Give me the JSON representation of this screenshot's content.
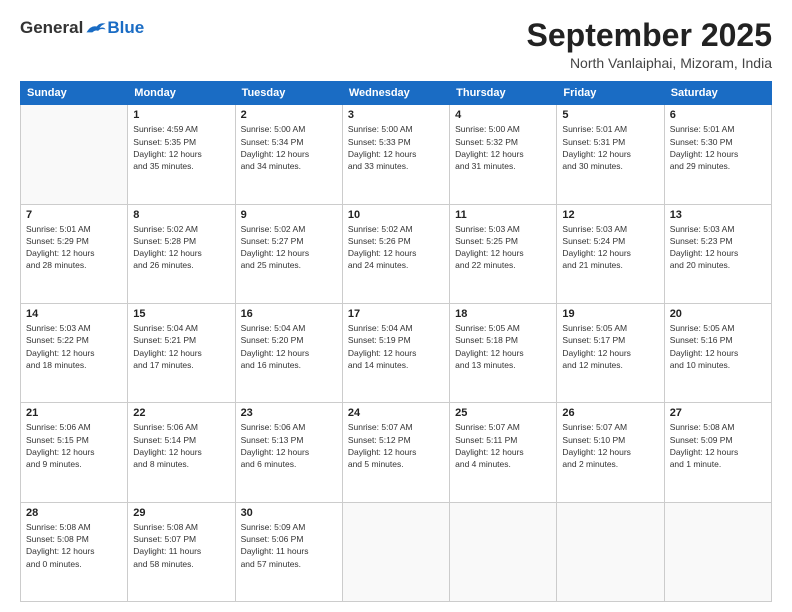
{
  "header": {
    "logo_general": "General",
    "logo_blue": "Blue",
    "month_title": "September 2025",
    "location": "North Vanlaiphai, Mizoram, India"
  },
  "weekdays": [
    "Sunday",
    "Monday",
    "Tuesday",
    "Wednesday",
    "Thursday",
    "Friday",
    "Saturday"
  ],
  "weeks": [
    [
      {
        "day": "",
        "info": ""
      },
      {
        "day": "1",
        "info": "Sunrise: 4:59 AM\nSunset: 5:35 PM\nDaylight: 12 hours\nand 35 minutes."
      },
      {
        "day": "2",
        "info": "Sunrise: 5:00 AM\nSunset: 5:34 PM\nDaylight: 12 hours\nand 34 minutes."
      },
      {
        "day": "3",
        "info": "Sunrise: 5:00 AM\nSunset: 5:33 PM\nDaylight: 12 hours\nand 33 minutes."
      },
      {
        "day": "4",
        "info": "Sunrise: 5:00 AM\nSunset: 5:32 PM\nDaylight: 12 hours\nand 31 minutes."
      },
      {
        "day": "5",
        "info": "Sunrise: 5:01 AM\nSunset: 5:31 PM\nDaylight: 12 hours\nand 30 minutes."
      },
      {
        "day": "6",
        "info": "Sunrise: 5:01 AM\nSunset: 5:30 PM\nDaylight: 12 hours\nand 29 minutes."
      }
    ],
    [
      {
        "day": "7",
        "info": "Sunrise: 5:01 AM\nSunset: 5:29 PM\nDaylight: 12 hours\nand 28 minutes."
      },
      {
        "day": "8",
        "info": "Sunrise: 5:02 AM\nSunset: 5:28 PM\nDaylight: 12 hours\nand 26 minutes."
      },
      {
        "day": "9",
        "info": "Sunrise: 5:02 AM\nSunset: 5:27 PM\nDaylight: 12 hours\nand 25 minutes."
      },
      {
        "day": "10",
        "info": "Sunrise: 5:02 AM\nSunset: 5:26 PM\nDaylight: 12 hours\nand 24 minutes."
      },
      {
        "day": "11",
        "info": "Sunrise: 5:03 AM\nSunset: 5:25 PM\nDaylight: 12 hours\nand 22 minutes."
      },
      {
        "day": "12",
        "info": "Sunrise: 5:03 AM\nSunset: 5:24 PM\nDaylight: 12 hours\nand 21 minutes."
      },
      {
        "day": "13",
        "info": "Sunrise: 5:03 AM\nSunset: 5:23 PM\nDaylight: 12 hours\nand 20 minutes."
      }
    ],
    [
      {
        "day": "14",
        "info": "Sunrise: 5:03 AM\nSunset: 5:22 PM\nDaylight: 12 hours\nand 18 minutes."
      },
      {
        "day": "15",
        "info": "Sunrise: 5:04 AM\nSunset: 5:21 PM\nDaylight: 12 hours\nand 17 minutes."
      },
      {
        "day": "16",
        "info": "Sunrise: 5:04 AM\nSunset: 5:20 PM\nDaylight: 12 hours\nand 16 minutes."
      },
      {
        "day": "17",
        "info": "Sunrise: 5:04 AM\nSunset: 5:19 PM\nDaylight: 12 hours\nand 14 minutes."
      },
      {
        "day": "18",
        "info": "Sunrise: 5:05 AM\nSunset: 5:18 PM\nDaylight: 12 hours\nand 13 minutes."
      },
      {
        "day": "19",
        "info": "Sunrise: 5:05 AM\nSunset: 5:17 PM\nDaylight: 12 hours\nand 12 minutes."
      },
      {
        "day": "20",
        "info": "Sunrise: 5:05 AM\nSunset: 5:16 PM\nDaylight: 12 hours\nand 10 minutes."
      }
    ],
    [
      {
        "day": "21",
        "info": "Sunrise: 5:06 AM\nSunset: 5:15 PM\nDaylight: 12 hours\nand 9 minutes."
      },
      {
        "day": "22",
        "info": "Sunrise: 5:06 AM\nSunset: 5:14 PM\nDaylight: 12 hours\nand 8 minutes."
      },
      {
        "day": "23",
        "info": "Sunrise: 5:06 AM\nSunset: 5:13 PM\nDaylight: 12 hours\nand 6 minutes."
      },
      {
        "day": "24",
        "info": "Sunrise: 5:07 AM\nSunset: 5:12 PM\nDaylight: 12 hours\nand 5 minutes."
      },
      {
        "day": "25",
        "info": "Sunrise: 5:07 AM\nSunset: 5:11 PM\nDaylight: 12 hours\nand 4 minutes."
      },
      {
        "day": "26",
        "info": "Sunrise: 5:07 AM\nSunset: 5:10 PM\nDaylight: 12 hours\nand 2 minutes."
      },
      {
        "day": "27",
        "info": "Sunrise: 5:08 AM\nSunset: 5:09 PM\nDaylight: 12 hours\nand 1 minute."
      }
    ],
    [
      {
        "day": "28",
        "info": "Sunrise: 5:08 AM\nSunset: 5:08 PM\nDaylight: 12 hours\nand 0 minutes."
      },
      {
        "day": "29",
        "info": "Sunrise: 5:08 AM\nSunset: 5:07 PM\nDaylight: 11 hours\nand 58 minutes."
      },
      {
        "day": "30",
        "info": "Sunrise: 5:09 AM\nSunset: 5:06 PM\nDaylight: 11 hours\nand 57 minutes."
      },
      {
        "day": "",
        "info": ""
      },
      {
        "day": "",
        "info": ""
      },
      {
        "day": "",
        "info": ""
      },
      {
        "day": "",
        "info": ""
      }
    ]
  ]
}
